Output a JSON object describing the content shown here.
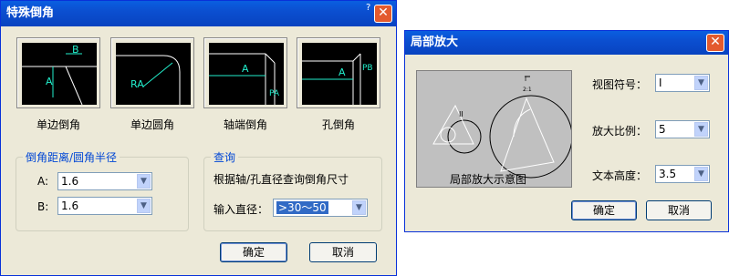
{
  "chamfer_dialog": {
    "title": "特殊倒角",
    "help": "?",
    "close": "✕",
    "types": [
      {
        "caption": "单边倒角",
        "lbl": "B",
        "lbl2": "A"
      },
      {
        "caption": "单边圆角",
        "lbl": "RA"
      },
      {
        "caption": "轴端倒角",
        "lbl": "A",
        "lbl2": "PA"
      },
      {
        "caption": "孔倒角",
        "lbl": "A",
        "lbl2": "PB"
      }
    ],
    "distance_group": {
      "legend": "倒角距离/圆角半径",
      "a_label": "A:",
      "a_value": "1.6",
      "b_label": "B:",
      "b_value": "1.6"
    },
    "query_group": {
      "legend": "查询",
      "description": "根据轴/孔直径查询倒角尺寸",
      "diameter_label": "输入直径：",
      "diameter_value": ">30～50"
    },
    "ok": "确定",
    "cancel": "取消"
  },
  "zoom_dialog": {
    "title": "局部放大",
    "close": "✕",
    "preview_caption": "局部放大示意图",
    "preview_marker_top": "I",
    "preview_marker_bottom": "2:1",
    "preview_marker_small": "II",
    "view_symbol_label": "视图符号：",
    "view_symbol_value": "I",
    "scale_label": "放大比例：",
    "scale_value": "5",
    "text_height_label": "文本高度：",
    "text_height_value": "3.5",
    "ok": "确定",
    "cancel": "取消"
  }
}
